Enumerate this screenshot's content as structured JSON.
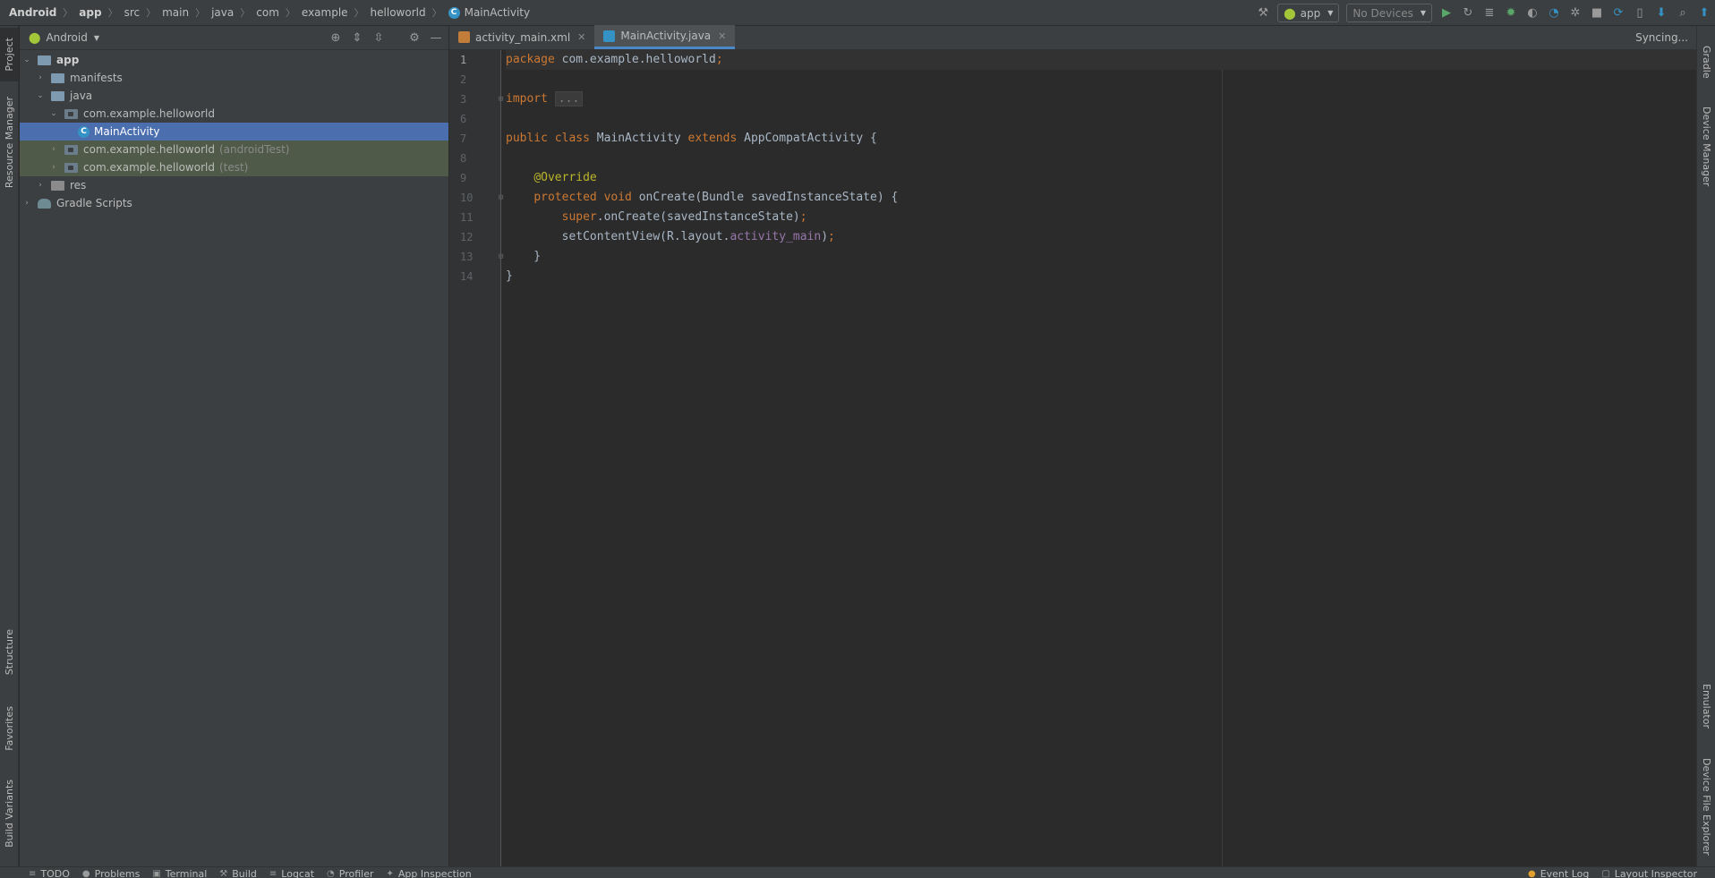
{
  "breadcrumbs": [
    "Android",
    "app",
    "src",
    "main",
    "java",
    "com",
    "example",
    "helloworld",
    "MainActivity"
  ],
  "toolbar": {
    "run_config": "app",
    "device": "No Devices"
  },
  "left_strip": {
    "project": "Project",
    "resource_manager": "Resource Manager",
    "structure": "Structure",
    "favorites": "Favorites",
    "build_variants": "Build Variants"
  },
  "right_strip": {
    "gradle": "Gradle",
    "device_manager": "Device Manager",
    "emulator": "Emulator",
    "device_file_explorer": "Device File Explorer"
  },
  "project_panel": {
    "view": "Android",
    "tree": [
      {
        "label": "app",
        "depth": 0,
        "kind": "module",
        "expanded": true
      },
      {
        "label": "manifests",
        "depth": 1,
        "kind": "folder",
        "expanded": false
      },
      {
        "label": "java",
        "depth": 1,
        "kind": "folder",
        "expanded": true
      },
      {
        "label": "com.example.helloworld",
        "depth": 2,
        "kind": "package",
        "expanded": true
      },
      {
        "label": "MainActivity",
        "depth": 3,
        "kind": "class",
        "selected": true
      },
      {
        "label": "com.example.helloworld",
        "suffix": "(androidTest)",
        "depth": 2,
        "kind": "package",
        "expanded": false,
        "highlight": true
      },
      {
        "label": "com.example.helloworld",
        "suffix": "(test)",
        "depth": 2,
        "kind": "package",
        "expanded": false,
        "highlight": true
      },
      {
        "label": "res",
        "depth": 1,
        "kind": "res",
        "expanded": false
      },
      {
        "label": "Gradle Scripts",
        "depth": 0,
        "kind": "gradle",
        "expanded": false
      }
    ]
  },
  "editor": {
    "tabs": [
      {
        "label": "activity_main.xml",
        "active": false
      },
      {
        "label": "MainActivity.java",
        "active": true
      }
    ],
    "line_numbers": [
      "1",
      "2",
      "3",
      "6",
      "7",
      "8",
      "9",
      "10",
      "11",
      "12",
      "13",
      "14"
    ],
    "status": "Syncing..."
  },
  "statusbar": {
    "items": [
      "TODO",
      "Problems",
      "Terminal",
      "Build",
      "Logcat",
      "Profiler",
      "App Inspection"
    ],
    "right_items": [
      "Event Log",
      "Layout Inspector"
    ]
  },
  "colors": {
    "accent": "#4b6eaf",
    "keyword": "#cc7832",
    "annotation": "#bbb529",
    "text": "#a9b7c6",
    "android_green": "#a4c639"
  }
}
